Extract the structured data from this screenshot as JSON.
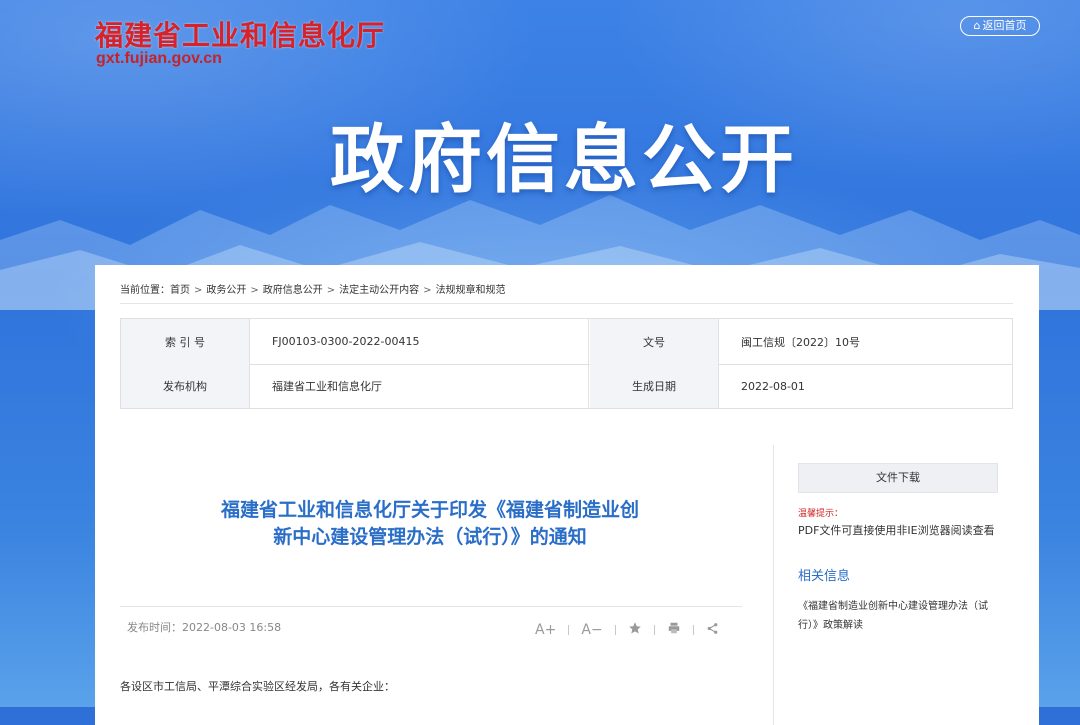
{
  "header": {
    "logo_cn": "福建省工业和信息化厅",
    "logo_en": "gxt.fujian.gov.cn",
    "home_button": "返回首页",
    "banner_title": "政府信息公开"
  },
  "breadcrumb": {
    "prefix": "当前位置：",
    "items": [
      "首页",
      "政务公开",
      "政府信息公开",
      "法定主动公开内容",
      "法规规章和规范"
    ],
    "separator": ">"
  },
  "meta_table": {
    "rows": [
      {
        "label_a": "索 引 号",
        "value_a": "FJ00103-0300-2022-00415",
        "label_b": "文号",
        "value_b": "闽工信规〔2022〕10号"
      },
      {
        "label_a": "发布机构",
        "value_a": "福建省工业和信息化厅",
        "label_b": "生成日期",
        "value_b": "2022-08-01"
      }
    ]
  },
  "article": {
    "title": "福建省工业和信息化厅关于印发《福建省制造业创新中心建设管理办法（试行）》的通知",
    "publish_time": "发布时间：2022-08-03 16:58",
    "tools": {
      "font_up": "A+",
      "font_down": "A−"
    },
    "body_first_line": "各设区市工信局、平潭综合实验区经发局，各有关企业："
  },
  "sidebar": {
    "download_button": "文件下载",
    "tip_label": "温馨提示：",
    "tip_text": "PDF文件可直接使用非IE浏览器阅读查看",
    "related_heading": "相关信息",
    "related_items": [
      "《福建省制造业创新中心建设管理办法（试行）》政策解读"
    ]
  },
  "colors": {
    "banner_blue": "#2f73dc",
    "logo_red": "#d8222a",
    "title_blue": "#2a6ec7",
    "tip_red": "#d02424"
  },
  "icons": [
    "home-icon",
    "star-icon",
    "print-icon",
    "share-icon"
  ]
}
